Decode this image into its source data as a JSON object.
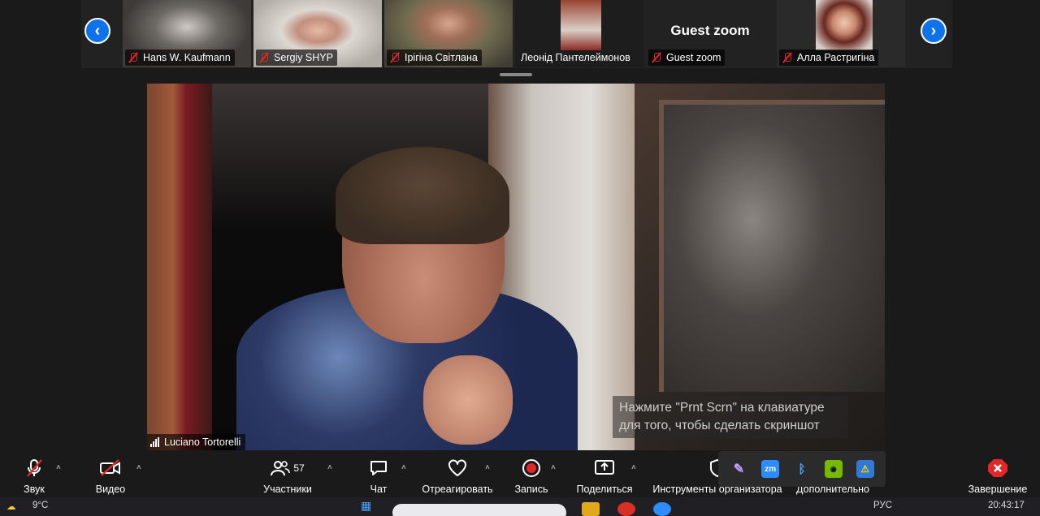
{
  "gallery": {
    "prev_label": "‹",
    "next_label": "›",
    "participants": [
      {
        "name": "Hans W. Kaufmann",
        "muted": true
      },
      {
        "name": "Sergiy SHYP",
        "muted": true
      },
      {
        "name": "Ірігіна  Світлана",
        "muted": true
      },
      {
        "name": "Леонід Пантелеймонов",
        "muted": false
      },
      {
        "name": "Guest zoom",
        "muted": true,
        "big_label": "Guest zoom"
      },
      {
        "name": "Алла Растригіна",
        "muted": true
      }
    ]
  },
  "main_video": {
    "speaker_name": "Luciano Tortorelli"
  },
  "hint": {
    "line1": "Нажмите \"Prnt Scrn\" на клавиатуре",
    "line2": "для того, чтобы сделать скриншот"
  },
  "toolbar": {
    "audio_label": "Звук",
    "video_label": "Видео",
    "participants_label": "Участники",
    "participants_count": "57",
    "chat_label": "Чат",
    "react_label": "Отреагировать",
    "record_label": "Запись",
    "share_label": "Поделиться",
    "host_tools_label": "Инструменты организатора",
    "more_label": "Дополнительно",
    "end_label": "Завершение",
    "caret": "˄"
  },
  "tray": {
    "items": [
      "feather-icon",
      "zm",
      "bluetooth-icon",
      "nvidia-icon",
      "security-icon"
    ],
    "zm_label": "zm"
  },
  "taskbar": {
    "weather": "9°C",
    "language": "РУС",
    "time": "20:43:17"
  },
  "colors": {
    "accent": "#0e72ed",
    "muted_red": "#e02828",
    "end_red": "#e02828"
  }
}
